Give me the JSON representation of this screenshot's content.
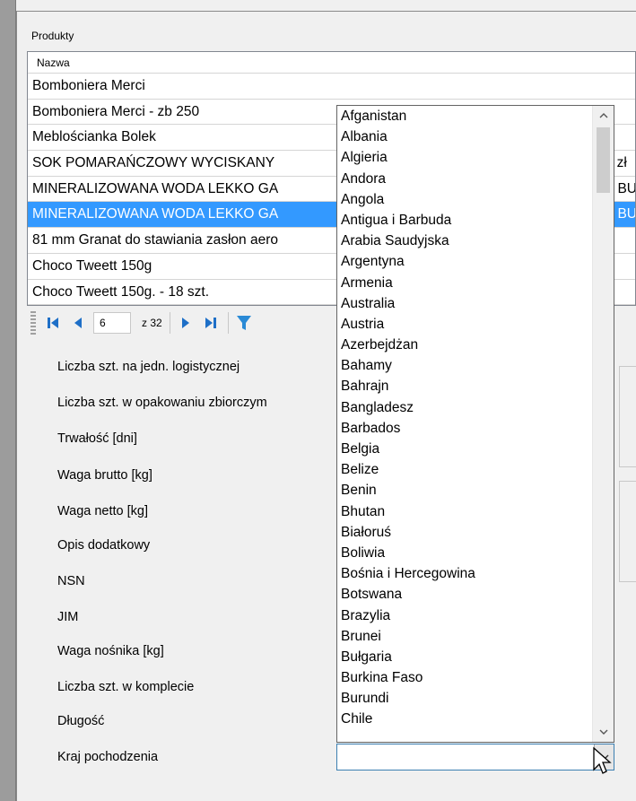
{
  "group_title": "Produkty",
  "grid": {
    "column_header": "Nazwa",
    "rows": [
      {
        "name": "Bomboniera Merci",
        "tail": ""
      },
      {
        "name": "Bomboniera Merci - zb 250",
        "tail": ""
      },
      {
        "name": "Meblościanka Bolek",
        "tail": ""
      },
      {
        "name": "SOK POMARAŃCZOWY WYCISKANY",
        "tail": ". zł"
      },
      {
        "name": "MINERALIZOWANA WODA LEKKO GA",
        "tail": "- BU"
      },
      {
        "name": "MINERALIZOWANA WODA LEKKO GA",
        "tail": "- BU"
      },
      {
        "name": "81 mm Granat do stawiania zasłon aero",
        "tail": ""
      },
      {
        "name": "Choco Tweett 150g",
        "tail": ""
      },
      {
        "name": "Choco Tweett 150g. - 18 szt.",
        "tail": ""
      }
    ],
    "selected_index": 5
  },
  "navigator": {
    "position": "6",
    "of_total": "z 32"
  },
  "form_labels": {
    "units_per_logistic": "Liczba szt. na jedn. logistycznej",
    "units_per_bulk": "Liczba szt. w opakowaniu zbiorczym",
    "shelf_life": "Trwałość  [dni]",
    "gross_weight": "Waga brutto [kg]",
    "net_weight": "Waga netto [kg]",
    "additional_desc": "Opis dodatkowy",
    "nsn": "NSN",
    "jim": "JIM",
    "carrier_weight": "Waga nośnika [kg]",
    "units_per_set": "Liczba szt. w komplecie",
    "length": "Długość",
    "country_of_origin": "Kraj pochodzenia"
  },
  "country_combo": {
    "value": "",
    "options": [
      "Afganistan",
      "Albania",
      "Algieria",
      "Andora",
      "Angola",
      "Antigua i Barbuda",
      "Arabia Saudyjska",
      "Argentyna",
      "Armenia",
      "Australia",
      "Austria",
      "Azerbejdżan",
      "Bahamy",
      "Bahrajn",
      "Bangladesz",
      "Barbados",
      "Belgia",
      "Belize",
      "Benin",
      "Bhutan",
      "Białoruś",
      "Boliwia",
      "Bośnia i Hercegowina",
      "Botswana",
      "Brazylia",
      "Brunei",
      "Bułgaria",
      "Burkina Faso",
      "Burundi",
      "Chile"
    ]
  },
  "colors": {
    "selection": "#3399ff",
    "nav_icon": "#1e6fc7",
    "filter_icon": "#2a8ad6"
  },
  "icons": [
    "first-record-icon",
    "previous-record-icon",
    "next-record-icon",
    "last-record-icon",
    "filter-icon",
    "scroll-up-icon",
    "scroll-down-icon",
    "dropdown-arrow-icon",
    "mouse-cursor-icon"
  ]
}
